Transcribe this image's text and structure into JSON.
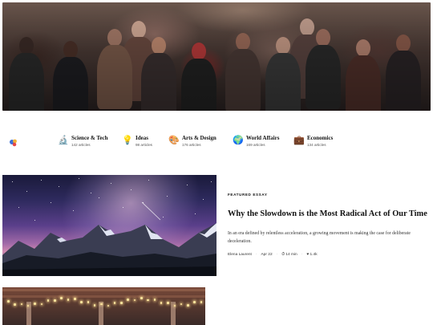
{
  "hero": {
    "alt_icon": "crowd-photo"
  },
  "categories": {
    "home_icon": "palette-blobs-icon",
    "items": [
      {
        "name": "Science & Tech",
        "count": "142 articles",
        "icon": "microscope-icon",
        "glyph": "🔬"
      },
      {
        "name": "Ideas",
        "count": "98 articles",
        "icon": "lightbulb-icon",
        "glyph": "💡"
      },
      {
        "name": "Arts & Design",
        "count": "176 articles",
        "icon": "palette-icon",
        "glyph": "🎨"
      },
      {
        "name": "World Affairs",
        "count": "169 articles",
        "icon": "globe-icon",
        "glyph": "🌍"
      },
      {
        "name": "Economics",
        "count": "134 articles",
        "icon": "briefcase-icon",
        "glyph": "💼"
      }
    ]
  },
  "featured": {
    "kicker": "FEATURED ESSAY",
    "title": "Why the Slowdown is the Most Radical Act of Our Time",
    "excerpt": "In an era defined by relentless acceleration, a growing movement is making the case for deliberate deceleration.",
    "author": "Elena Laurent",
    "date": "Apr 22",
    "read_time": "14 min",
    "likes": "1.4k"
  }
}
